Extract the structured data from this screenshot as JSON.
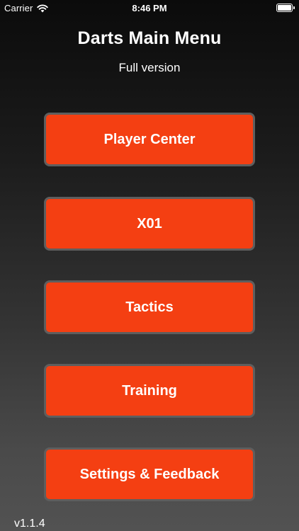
{
  "status_bar": {
    "carrier": "Carrier",
    "time": "8:46 PM",
    "wifi_icon": "wifi-icon",
    "battery_icon": "battery-icon",
    "battery_level": 1.0
  },
  "header": {
    "title": "Darts Main Menu",
    "subtitle": "Full version"
  },
  "menu": {
    "items": [
      {
        "label": "Player Center"
      },
      {
        "label": "X01"
      },
      {
        "label": "Tactics"
      },
      {
        "label": "Training"
      },
      {
        "label": "Settings & Feedback"
      }
    ]
  },
  "footer": {
    "version": "v1.1.4"
  },
  "colors": {
    "button_fill": "#f43f12",
    "button_border": "#5e5e5e",
    "background_top": "#0b0b0b",
    "background_bottom": "#525252",
    "text": "#ffffff"
  }
}
